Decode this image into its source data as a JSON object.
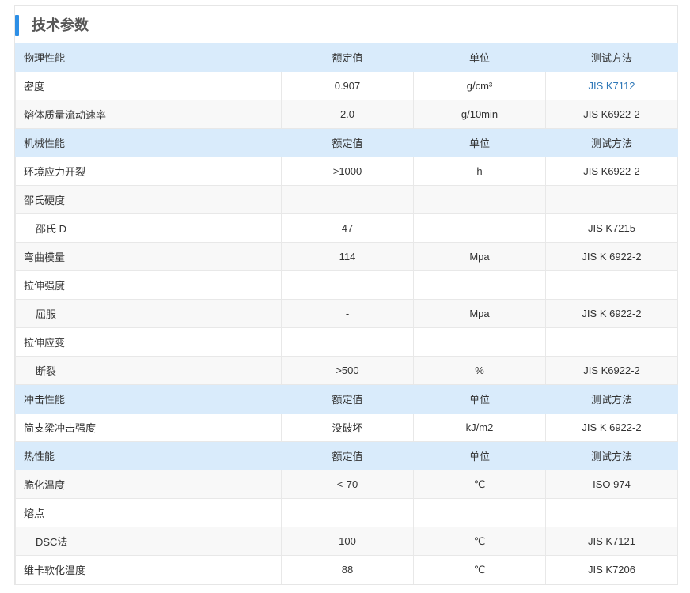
{
  "panel": {
    "title": "技术参数"
  },
  "colors": {
    "accent": "#2d8fe6",
    "section_bg": "#d9ebfb",
    "link": "#2f78b8"
  },
  "rows": [
    {
      "type": "section",
      "cells": [
        "物理性能",
        "额定值",
        "单位",
        "测试方法"
      ]
    },
    {
      "type": "data",
      "indent": false,
      "cells": [
        "密度",
        "0.907",
        "g/cm³",
        "JIS K7112"
      ],
      "link_col": 3
    },
    {
      "type": "data",
      "indent": false,
      "cells": [
        "熔体质量流动速率",
        "2.0",
        "g/10min",
        "JIS K6922-2"
      ]
    },
    {
      "type": "section",
      "cells": [
        "机械性能",
        "额定值",
        "单位",
        "测试方法"
      ]
    },
    {
      "type": "data",
      "indent": false,
      "cells": [
        "环境应力开裂",
        ">1000",
        "h",
        "JIS K6922-2"
      ]
    },
    {
      "type": "data",
      "indent": false,
      "cells": [
        "邵氏硬度",
        "",
        "",
        ""
      ]
    },
    {
      "type": "data",
      "indent": true,
      "cells": [
        "邵氏 D",
        "47",
        "",
        "JIS K7215"
      ]
    },
    {
      "type": "data",
      "indent": false,
      "cells": [
        "弯曲模量",
        "114",
        "Mpa",
        "JIS K 6922-2"
      ]
    },
    {
      "type": "data",
      "indent": false,
      "cells": [
        "拉伸强度",
        "",
        "",
        ""
      ]
    },
    {
      "type": "data",
      "indent": true,
      "cells": [
        "屈服",
        "-",
        "Mpa",
        "JIS K 6922-2"
      ]
    },
    {
      "type": "data",
      "indent": false,
      "cells": [
        "拉伸应变",
        "",
        "",
        ""
      ]
    },
    {
      "type": "data",
      "indent": true,
      "cells": [
        "断裂",
        ">500",
        "%",
        "JIS K6922-2"
      ]
    },
    {
      "type": "section",
      "cells": [
        "冲击性能",
        "额定值",
        "单位",
        "测试方法"
      ]
    },
    {
      "type": "data",
      "indent": false,
      "cells": [
        "简支梁冲击强度",
        "没破坏",
        "kJ/m2",
        "JIS K 6922-2"
      ]
    },
    {
      "type": "section",
      "cells": [
        "热性能",
        "额定值",
        "单位",
        "测试方法"
      ]
    },
    {
      "type": "data",
      "indent": false,
      "cells": [
        "脆化温度",
        "<-70",
        "℃",
        "ISO 974"
      ]
    },
    {
      "type": "data",
      "indent": false,
      "cells": [
        "熔点",
        "",
        "",
        ""
      ]
    },
    {
      "type": "data",
      "indent": true,
      "cells": [
        "DSC法",
        "100",
        "℃",
        "JIS K7121"
      ]
    },
    {
      "type": "data",
      "indent": false,
      "cells": [
        "维卡软化温度",
        "88",
        "℃",
        "JIS K7206"
      ]
    }
  ]
}
